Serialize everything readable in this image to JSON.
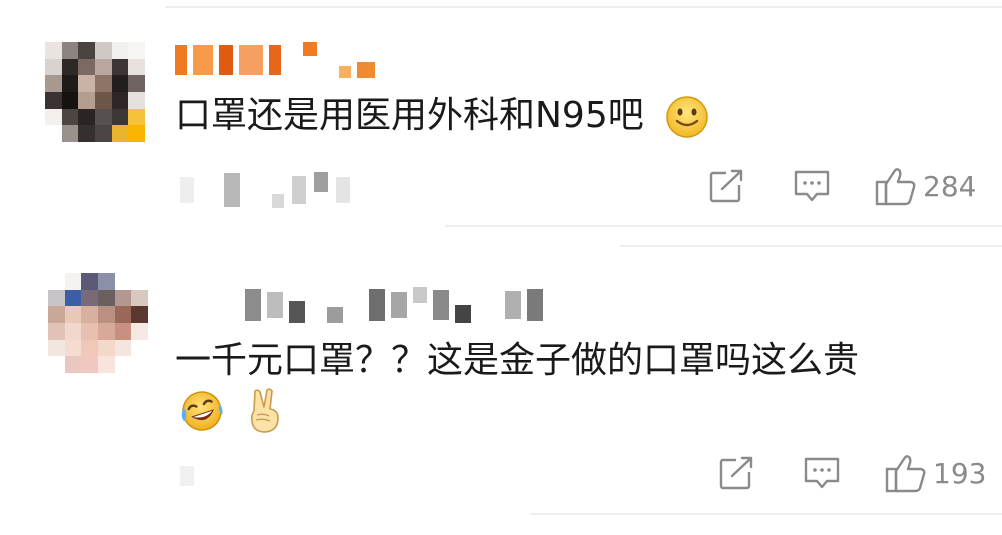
{
  "comments": [
    {
      "text": "口罩还是用医用外科和N95吧",
      "emoji_names": [
        "smile-emoji"
      ],
      "likes": "284"
    },
    {
      "text": "一千元口罩？？这是金子做的口罩吗这么贵",
      "emoji_names": [
        "laughing-crying-emoji",
        "victory-hand-emoji"
      ],
      "likes": "193"
    }
  ],
  "icons": {
    "share": "share-icon",
    "comment": "comment-icon",
    "like": "thumbs-up-icon"
  }
}
